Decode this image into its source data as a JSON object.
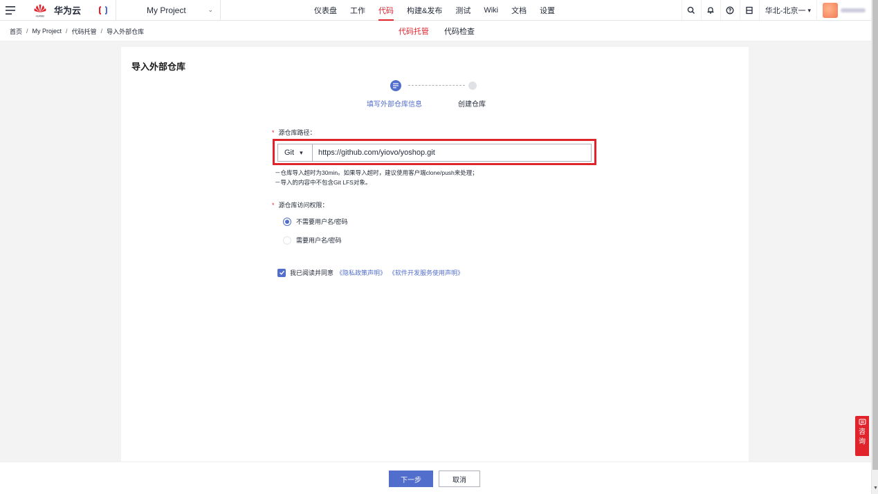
{
  "topbar": {
    "brand": "华为云",
    "brand_sub": "HUAWEI",
    "project_name": "My Project",
    "nav_items": [
      "仪表盘",
      "工作",
      "代码",
      "构建&发布",
      "测试",
      "Wiki",
      "文档",
      "设置"
    ],
    "active_nav": "代码",
    "region": "华北-北京一",
    "accent_color": "#e1232c"
  },
  "breadcrumb": [
    "首页",
    "My Project",
    "代码托管",
    "导入外部仓库"
  ],
  "subtabs": [
    "代码托管",
    "代码检查"
  ],
  "page": {
    "title": "导入外部仓库",
    "steps": [
      "填写外部仓库信息",
      "创建仓库"
    ],
    "source_label": "源仓库路径：",
    "scheme_value": "Git",
    "url_value": "https://github.com/yiovo/yoshop.git",
    "hints": [
      "－仓库导入超时为30min。如果导入超时，建议使用客户端clone/push来处理；",
      "－导入的内容中不包含Git LFS对象。"
    ],
    "access_label": "源仓库访问权限：",
    "radio_options": [
      "不需要用户名/密码",
      "需要用户名/密码"
    ],
    "selected_radio": "不需要用户名/密码",
    "agree_text": "我已阅读并同意",
    "link_privacy": "《隐私政策声明》",
    "link_service": "《软件开发服务使用声明》",
    "agree_checked": true,
    "primary_color": "#526ecc"
  },
  "footer": {
    "next_label": "下一步",
    "cancel_label": "取消"
  },
  "consult": [
    "咨",
    "询"
  ]
}
